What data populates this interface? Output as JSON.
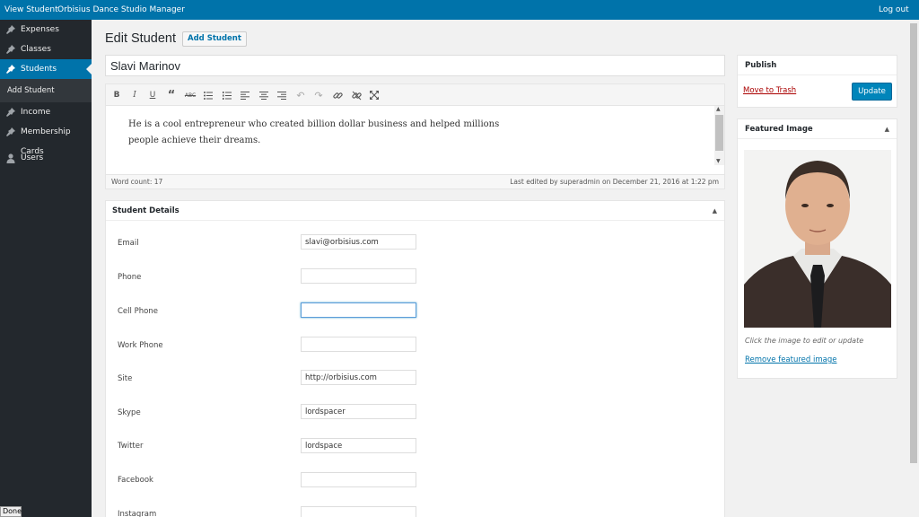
{
  "adminbar": {
    "view_student": "View Student",
    "site_name": "Orbisius Dance Studio Manager",
    "logout": "Log out"
  },
  "sidebar": {
    "items": [
      {
        "label": "Expenses",
        "icon": "pin-icon"
      },
      {
        "label": "Classes",
        "icon": "pin-icon"
      },
      {
        "label": "Students",
        "icon": "pin-icon",
        "active": true
      },
      {
        "label": "Add Student",
        "submenu": true
      },
      {
        "label": "Income",
        "icon": "pin-icon"
      },
      {
        "label": "Membership Cards",
        "icon": "pin-icon"
      },
      {
        "label": "Users",
        "icon": "user-icon"
      }
    ]
  },
  "status": "Done",
  "page": {
    "heading": "Edit Student",
    "add_button": "Add Student",
    "title_value": "Slavi Marinov"
  },
  "editor": {
    "content": "He is a cool entrepreneur who created billion dollar business and helped millions people achieve their dreams.",
    "word_count": "Word count: 17",
    "last_edited": "Last edited by superadmin on December 21, 2016 at 1:22 pm",
    "toolbar": [
      "bold",
      "italic",
      "underline",
      "blockquote",
      "strikethrough",
      "bullet-list",
      "numbered-list",
      "align-left",
      "align-center",
      "align-right",
      "undo",
      "redo",
      "link",
      "unlink",
      "fullscreen"
    ]
  },
  "details": {
    "title": "Student Details",
    "fields": [
      {
        "label": "Email",
        "value": "slavi@orbisius.com"
      },
      {
        "label": "Phone",
        "value": ""
      },
      {
        "label": "Cell Phone",
        "value": "",
        "focused": true
      },
      {
        "label": "Work Phone",
        "value": ""
      },
      {
        "label": "Site",
        "value": "http://orbisius.com"
      },
      {
        "label": "Skype",
        "value": "lordspacer"
      },
      {
        "label": "Twitter",
        "value": "lordspace"
      },
      {
        "label": "Facebook",
        "value": ""
      },
      {
        "label": "Instagram",
        "value": ""
      }
    ]
  },
  "publish": {
    "title": "Publish",
    "trash": "Move to Trash",
    "update": "Update"
  },
  "featured": {
    "title": "Featured Image",
    "note": "Click the image to edit or update",
    "remove": "Remove featured image"
  },
  "colors": {
    "accent": "#0073aa",
    "sidebar": "#23282d",
    "trash": "#a00000"
  }
}
